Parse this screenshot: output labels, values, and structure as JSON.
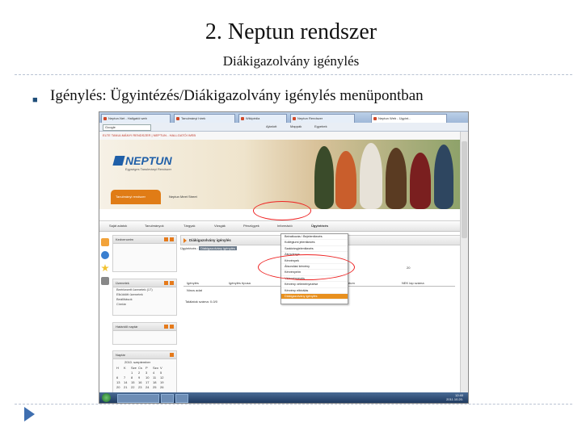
{
  "slide": {
    "title": "2. Neptun rendszer",
    "subtitle": "Diákigazolvány igénylés",
    "bullet": "Igénylés: Ügyintézés/Diákigazolvány igénylés menüpontban"
  },
  "browser": {
    "tabs": [
      "Neptun.Net - Hallgatói web",
      "Tanulmányi hírek",
      "Wikipédia",
      "Neptun Rendszer",
      "Neptun Web - Ügyint..."
    ],
    "search_engine": "Google",
    "toolbar_items": [
      "Ajánlott",
      "Mappák",
      "Egyebek"
    ]
  },
  "neptun": {
    "logo": "NEPTUN",
    "logo_sub": "Egységes Tanulmányi Rendszer",
    "top_strip": "ELTE TANULMÁNYI RENDSZER | NEPTUN - HALLGATÓI WEB",
    "header_tabs": [
      "Tanulmányi rendszer",
      "Neptun Meet Street"
    ],
    "menu": [
      "Saját adatok",
      "Tanulmányok",
      "Tárgyak",
      "Vizsgák",
      "Pénzügyek",
      "Információ",
      "Ügyintézés"
    ],
    "left_boxes": {
      "favorites": "Kedvenceim",
      "messages": "Üzenetek",
      "message_items": [
        "Beérkezett üzenetek (17)",
        "Elküldött üzenetek",
        "Beállítások",
        "Címtár"
      ],
      "calendar_title": "Határidő naptár",
      "calendar": "Naptár",
      "calendar_month": "2010. szeptember"
    },
    "main_title": "Diákigazolvány igénylés",
    "main_crumb": "Ügyintézés",
    "main_filter": "Diákigazolvány igénylés",
    "table_headers": [
      "Igénylés",
      "Igénylés típusa",
      "Állapot",
      "Dátum",
      "NEK lap száma"
    ],
    "table_row": "Nincs adat",
    "table_footer": "Találatok száma: 0-0/0",
    "per_page": "20"
  },
  "dropdown_items": [
    "Beiratkozás / Bejelentkezés",
    "Kollégiumi jelentkezés",
    "Szakirányjelentkezés",
    "Záróvizsga",
    "Kérvények",
    "Átsorolási kérvény",
    "Kérvényeim",
    "Véleményezés",
    "Kérvény véleményezése",
    "Kérvény elbírálás",
    "Diákigazolvány igénylés"
  ],
  "calendar": {
    "weekdays": [
      "H",
      "K",
      "Sze",
      "Cs",
      "P",
      "Szo",
      "V"
    ],
    "rows": [
      [
        "",
        "",
        "1",
        "2",
        "3",
        "4",
        "5"
      ],
      [
        "6",
        "7",
        "8",
        "9",
        "10",
        "11",
        "12"
      ],
      [
        "13",
        "14",
        "15",
        "16",
        "17",
        "18",
        "19"
      ],
      [
        "20",
        "21",
        "22",
        "23",
        "24",
        "25",
        "26"
      ]
    ]
  },
  "taskbar": {
    "clock_time": "12:40",
    "clock_date": "2011.10.20."
  },
  "colors": {
    "accent_orange": "#e8901e",
    "neptun_blue": "#1f5fa8",
    "highlight_red": "#e22222",
    "taskbar": "#1f3a60"
  }
}
